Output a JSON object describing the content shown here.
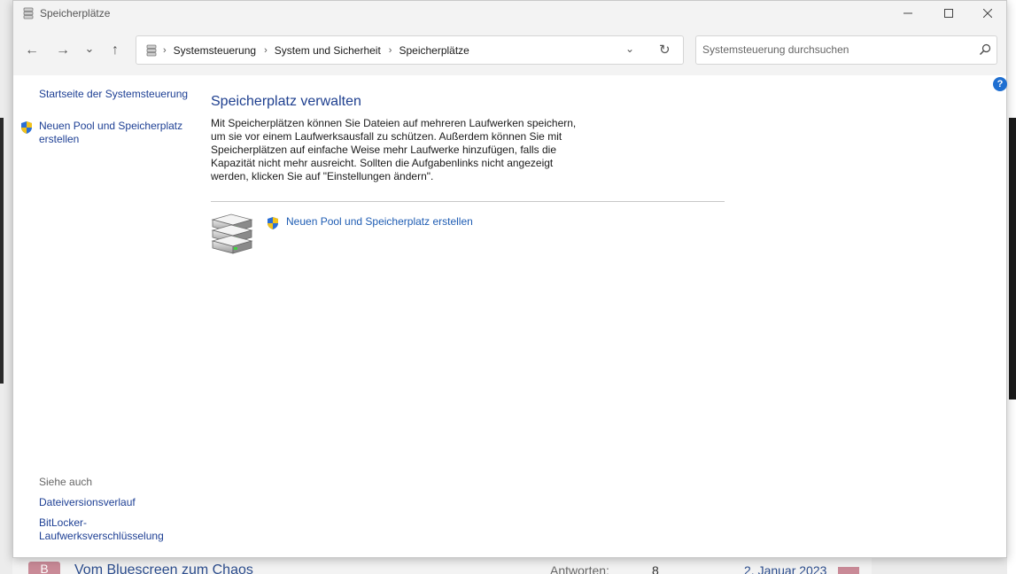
{
  "window": {
    "title": "Speicherplätze",
    "controls": {
      "minimize": "—",
      "maximize": "☐",
      "close": "✕"
    }
  },
  "nav": {
    "back": "←",
    "forward": "→",
    "recent": "⌄",
    "up": "↑",
    "breadcrumbs": [
      "Systemsteuerung",
      "System und Sicherheit",
      "Speicherplätze"
    ],
    "separator": "›",
    "dropdown": "⌄",
    "refresh": "↻"
  },
  "search": {
    "placeholder": "Systemsteuerung durchsuchen"
  },
  "help": {
    "label": "?"
  },
  "sidebar": {
    "home_link": "Startseite der Systemsteuerung",
    "new_pool_link": "Neuen Pool und Speicherplatz erstellen",
    "see_also_title": "Siehe auch",
    "see_also": [
      "Dateiversionsverlauf",
      "BitLocker-Laufwerksverschlüsselung"
    ]
  },
  "main": {
    "heading": "Speicherplatz verwalten",
    "description": "Mit Speicherplätzen können Sie Dateien auf mehreren Laufwerken speichern, um sie vor einem Laufwerksausfall zu schützen. Außerdem können Sie mit Speicherplätzen auf einfache Weise mehr Laufwerke hinzufügen, falls die Kapazität nicht mehr ausreicht. Sollten die Aufgabenlinks nicht angezeigt werden, klicken Sie auf \"Einstellungen ändern\".",
    "task_link": "Neuen Pool und Speicherplatz erstellen"
  },
  "background_page": {
    "avatar_letter": "B",
    "thread_title": "Vom Bluescreen zum Chaos",
    "answers_label": "Antworten:",
    "answers_count": "8",
    "date": "2. Januar 2023"
  },
  "colors": {
    "link": "#1d3f94",
    "heading": "#1e3f8f",
    "titlebar": "#f3f3f3",
    "help_badge": "#1f6fd1",
    "shield_blue": "#2b6fd6",
    "shield_yellow": "#f2c21a"
  }
}
